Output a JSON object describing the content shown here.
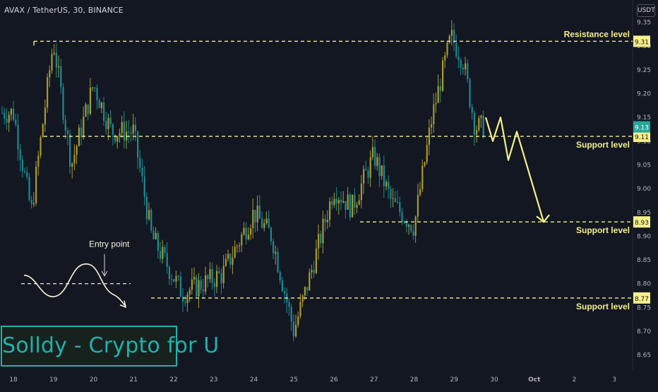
{
  "header": {
    "symbol": "AVAX / TetherUS, 30, BINANCE",
    "currency": "USDT"
  },
  "brand": {
    "text": "Solldy - Crypto for U"
  },
  "colors": {
    "background": "#131722",
    "bull": "#a89a2e",
    "bear": "#1f8a8f",
    "level_line": "#f5f08a",
    "axis_text": "#b2b5be",
    "brand": "#20b2aa"
  },
  "chart_data": {
    "type": "candlestick",
    "x_axis": {
      "labels": [
        "18",
        "19",
        "20",
        "21",
        "22",
        "23",
        "24",
        "25",
        "26",
        "27",
        "28",
        "29",
        "30",
        "Oct",
        "2",
        "3"
      ]
    },
    "y_axis": {
      "ticks": [
        "8.65",
        "8.70",
        "8.75",
        "8.80",
        "8.85",
        "8.90",
        "8.95",
        "9.00",
        "9.05",
        "9.10",
        "9.15",
        "9.20",
        "9.25",
        "9.30",
        "9.35"
      ],
      "range": [
        8.62,
        9.37
      ]
    },
    "current_price": {
      "value": 9.13,
      "label": "9.13"
    },
    "levels": [
      {
        "name": "Resistance level",
        "price": 9.31,
        "label": "9.31",
        "from": "18"
      },
      {
        "name": "Support level",
        "price": 9.11,
        "label": "9.11",
        "from": "18"
      },
      {
        "name": "Support level",
        "price": 8.93,
        "label": "8.93",
        "from": "27"
      },
      {
        "name": "Support level",
        "price": 8.77,
        "label": "8.77",
        "from": "21"
      }
    ],
    "annotations": [
      {
        "text": "Entry point",
        "price": 8.8
      }
    ],
    "path_points": [
      {
        "x": "18",
        "y": 9.16
      },
      {
        "x": "18",
        "y": 8.95
      },
      {
        "x": "19",
        "y": 9.31
      },
      {
        "x": "19",
        "y": 9.05
      },
      {
        "x": "20",
        "y": 9.22
      },
      {
        "x": "20",
        "y": 9.12
      },
      {
        "x": "21",
        "y": 9.12
      },
      {
        "x": "21",
        "y": 8.9
      },
      {
        "x": "22",
        "y": 8.78
      },
      {
        "x": "23",
        "y": 8.82
      },
      {
        "x": "24",
        "y": 8.95
      },
      {
        "x": "24",
        "y": 8.9
      },
      {
        "x": "25",
        "y": 8.7
      },
      {
        "x": "25",
        "y": 8.83
      },
      {
        "x": "26",
        "y": 9.0
      },
      {
        "x": "26",
        "y": 8.96
      },
      {
        "x": "27",
        "y": 9.07
      },
      {
        "x": "27",
        "y": 8.97
      },
      {
        "x": "28",
        "y": 8.92
      },
      {
        "x": "28",
        "y": 9.15
      },
      {
        "x": "29",
        "y": 9.32
      },
      {
        "x": "29",
        "y": 9.27
      },
      {
        "x": "29",
        "y": 9.13
      }
    ],
    "projection": [
      {
        "x": "29",
        "y": 9.15
      },
      {
        "x": "30",
        "y": 9.1
      },
      {
        "x": "30",
        "y": 9.15
      },
      {
        "x": "30",
        "y": 9.06
      },
      {
        "x": "30",
        "y": 9.12
      },
      {
        "x": "Oct",
        "y": 8.93
      }
    ]
  }
}
